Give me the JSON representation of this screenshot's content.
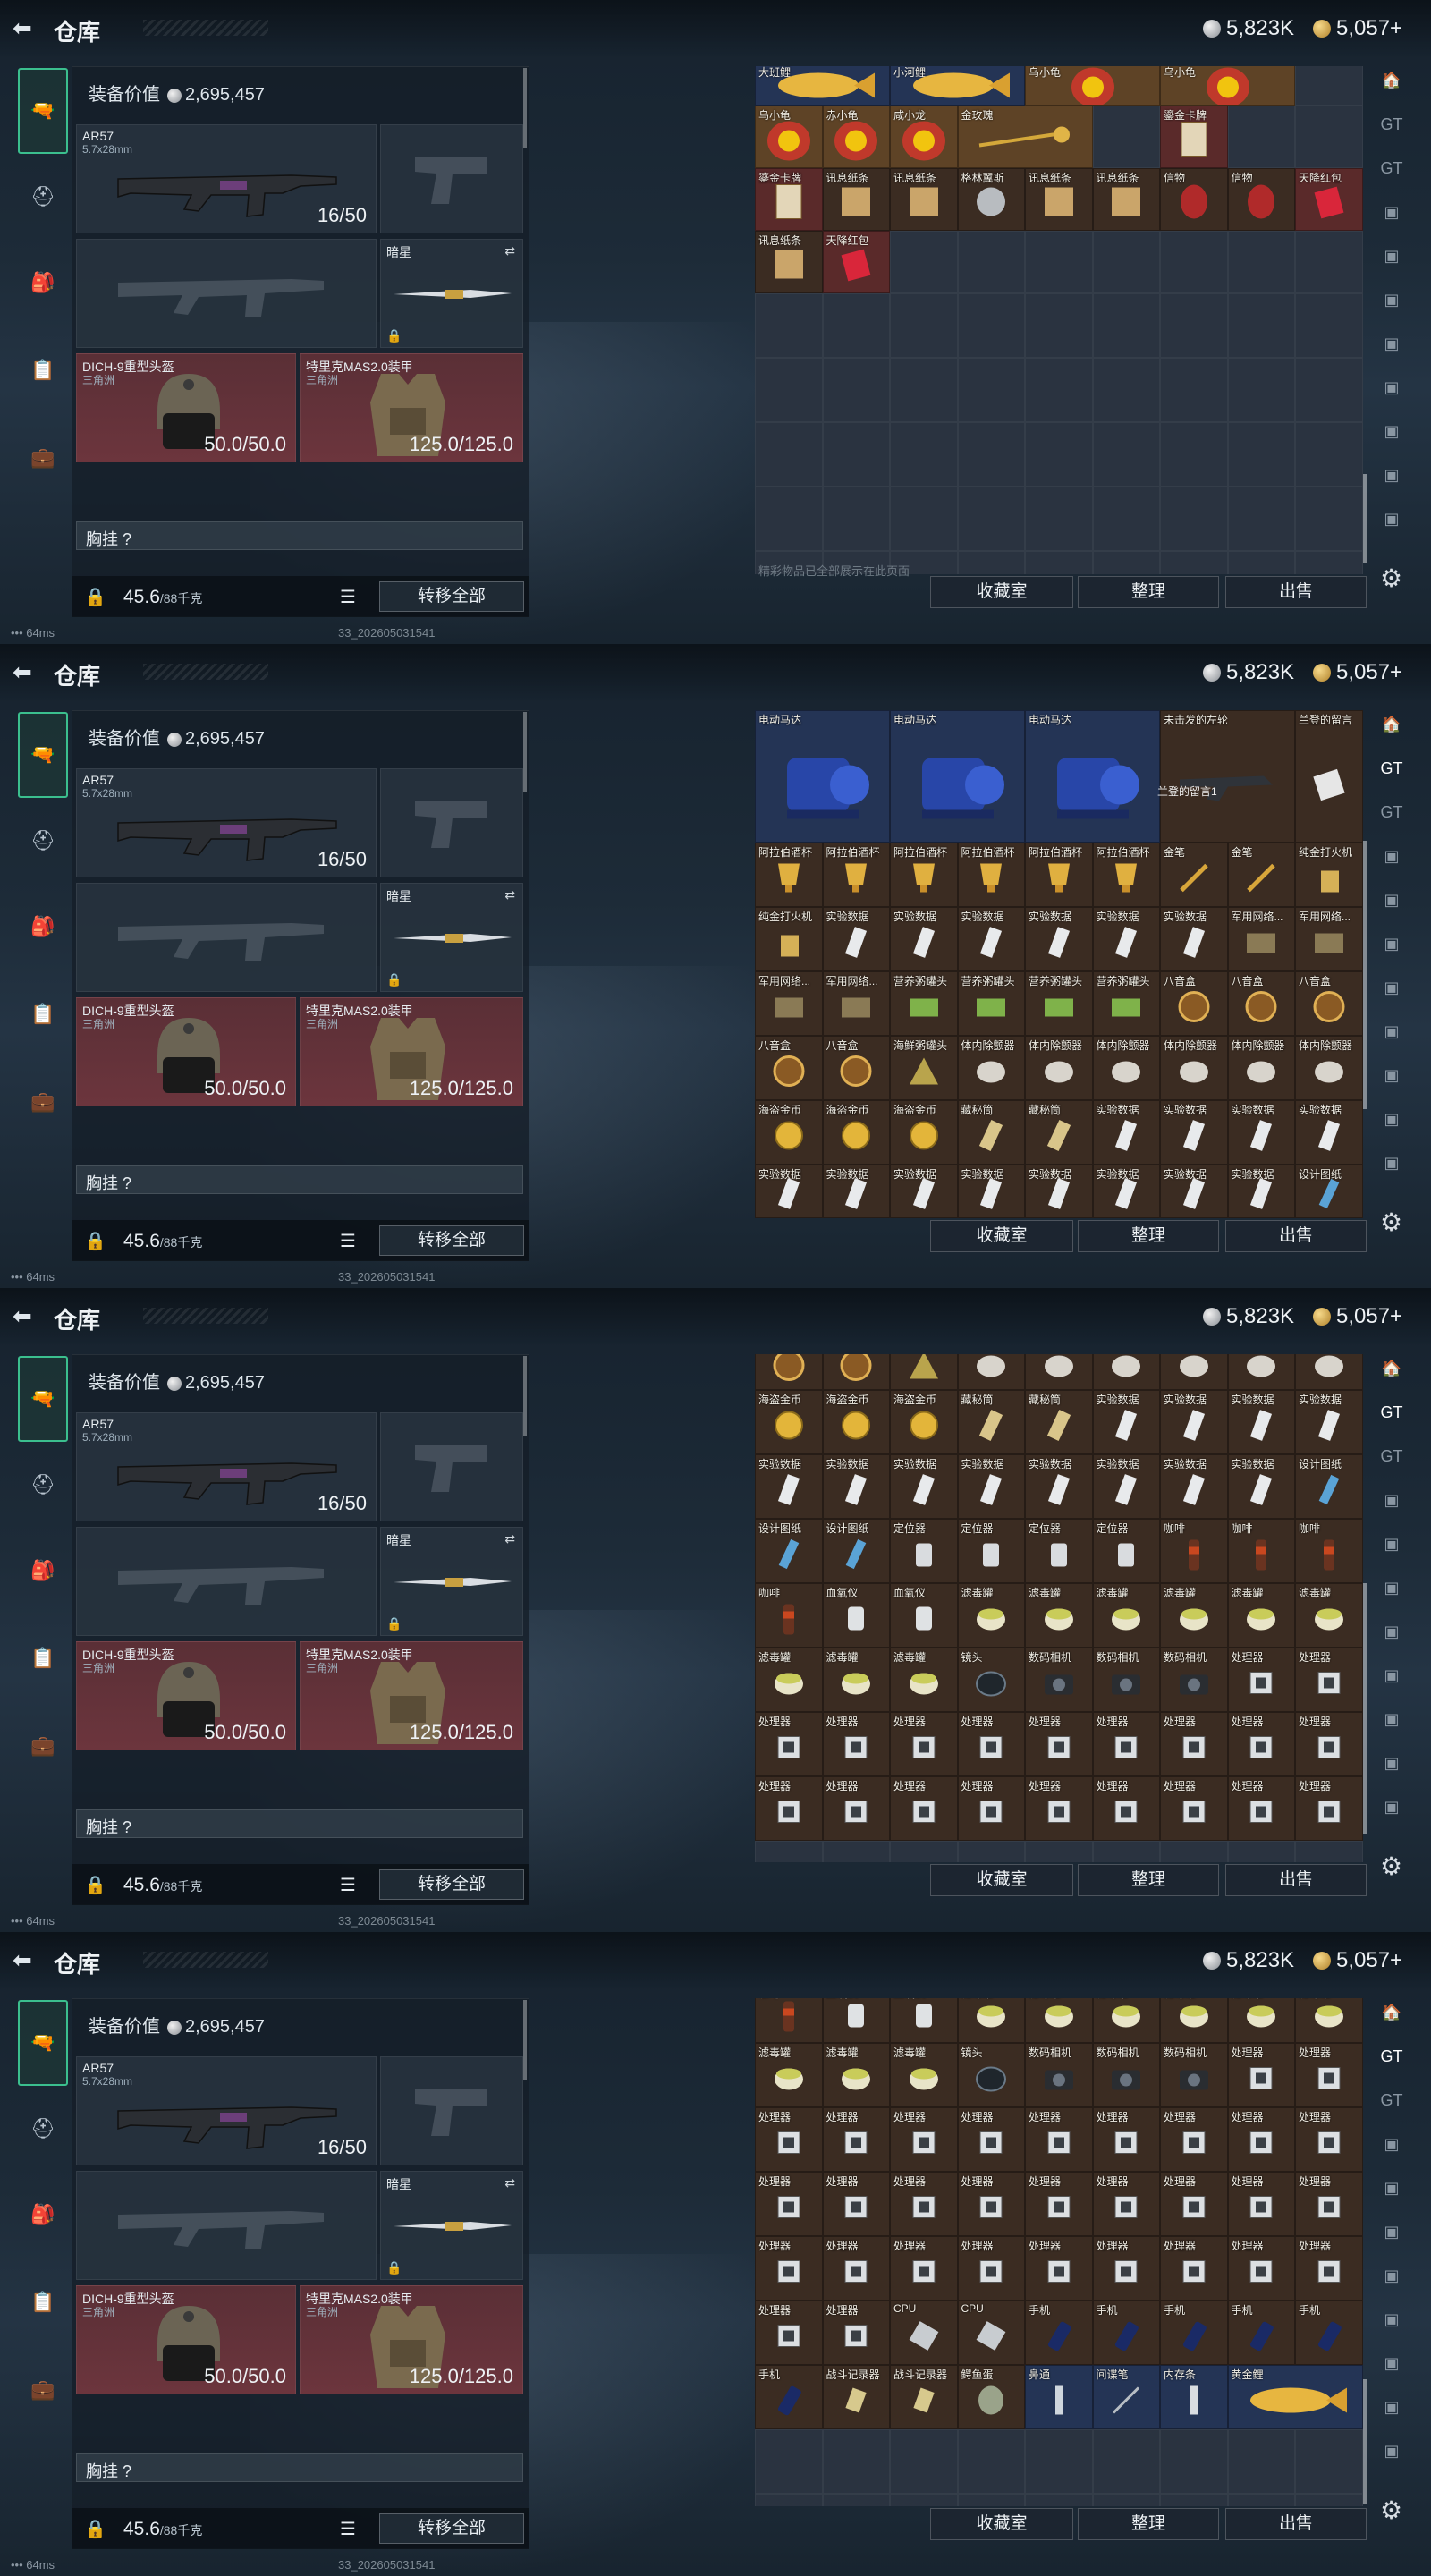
{
  "header": {
    "title": "仓库",
    "silver": "5,823K",
    "gold": "5,057+"
  },
  "equip": {
    "value_label": "装备价值",
    "value": "2,695,457",
    "weapon": {
      "name": "AR57",
      "ammo": "5.7x28mm",
      "count": "16/50"
    },
    "melee": {
      "name": "暗星"
    },
    "helmet": {
      "name": "DICH-9重型头盔",
      "sub": "三角洲",
      "dur": "50.0/50.0"
    },
    "armor": {
      "name": "特里克MAS2.0装甲",
      "sub": "三角洲",
      "dur": "125.0/125.0"
    },
    "chest": "胸挂 ?",
    "weight": "45.6",
    "weight_unit": "/88千克",
    "transfer": "转移全部"
  },
  "actions": {
    "collect": "收藏室",
    "sort": "整理",
    "sell": "出售"
  },
  "status": {
    "ping": "64ms",
    "version": "33_202605031541"
  },
  "panels": [
    {
      "rows": [
        [
          "大班鲤",
          "小河鲤",
          "乌小龟",
          "乌小龟",
          ""
        ],
        [
          "乌小龟",
          "赤小龟",
          "咸小龙",
          "金玫瑰",
          "",
          "鎏金卡牌"
        ],
        [
          "鎏金卡牌",
          "讯息纸条",
          "讯息纸条",
          "格林翼斯",
          "讯息纸条",
          "讯息纸条",
          "信物",
          "信物",
          "天降红包"
        ],
        [
          "讯息纸条",
          "天降红包"
        ]
      ],
      "fade": "精彩物品已全部展示在此页面"
    },
    {
      "rows": [
        [
          "电动马达",
          "电动马达",
          "电动马达",
          "未击发的左轮",
          "兰登的留言"
        ],
        [
          "阿拉伯酒杯",
          "阿拉伯酒杯",
          "阿拉伯酒杯",
          "阿拉伯酒杯",
          "阿拉伯酒杯",
          "阿拉伯酒杯",
          "金笔",
          "金笔",
          "纯金打火机"
        ],
        [
          "纯金打火机",
          "实验数据",
          "实验数据",
          "实验数据",
          "实验数据",
          "实验数据",
          "实验数据",
          "军用网络...",
          "军用网络..."
        ],
        [
          "军用网络...",
          "军用网络...",
          "营养粥罐头",
          "营养粥罐头",
          "营养粥罐头",
          "营养粥罐头",
          "八音盒",
          "八音盒",
          "八音盒"
        ],
        [
          "八音盒",
          "八音盒",
          "海鲜粥罐头",
          "体内除颤器",
          "体内除颤器",
          "体内除颤器",
          "体内除颤器",
          "体内除颤器",
          "体内除颤器"
        ],
        [
          "海盗金币",
          "海盗金币",
          "海盗金币",
          "藏秘筒",
          "藏秘筒",
          "实验数据",
          "实验数据",
          "实验数据",
          "实验数据"
        ],
        [
          "实验数据",
          "实验数据",
          "实验数据",
          "实验数据",
          "实验数据",
          "实验数据",
          "实验数据",
          "实验数据",
          "设计图纸"
        ]
      ],
      "note": "兰登的留言1"
    },
    {
      "rows": [
        [
          "八音盒",
          "八音盒",
          "海鲜粥罐头",
          "体内除颤器",
          "体内除颤器",
          "体内除颤器",
          "体内除颤器",
          "体内除颤器",
          "体内除颤器"
        ],
        [
          "海盗金币",
          "海盗金币",
          "海盗金币",
          "藏秘筒",
          "藏秘筒",
          "实验数据",
          "实验数据",
          "实验数据",
          "实验数据"
        ],
        [
          "实验数据",
          "实验数据",
          "实验数据",
          "实验数据",
          "实验数据",
          "实验数据",
          "实验数据",
          "实验数据",
          "设计图纸"
        ],
        [
          "设计图纸",
          "设计图纸",
          "定位器",
          "定位器",
          "定位器",
          "定位器",
          "咖啡",
          "咖啡",
          "咖啡"
        ],
        [
          "咖啡",
          "血氧仪",
          "血氧仪",
          "滤毒罐",
          "滤毒罐",
          "滤毒罐",
          "滤毒罐",
          "滤毒罐",
          "滤毒罐"
        ],
        [
          "滤毒罐",
          "滤毒罐",
          "滤毒罐",
          "镜头",
          "数码相机",
          "数码相机",
          "数码相机",
          "处理器",
          "处理器"
        ],
        [
          "处理器",
          "处理器",
          "处理器",
          "处理器",
          "处理器",
          "处理器",
          "处理器",
          "处理器",
          "处理器"
        ],
        [
          "处理器",
          "处理器",
          "处理器",
          "处理器",
          "处理器",
          "处理器",
          "处理器",
          "处理器",
          "处理器"
        ]
      ]
    },
    {
      "rows": [
        [
          "咖啡",
          "血氧仪",
          "血氧仪",
          "滤毒罐",
          "滤毒罐",
          "滤毒罐",
          "滤毒罐",
          "滤毒罐",
          "滤毒罐"
        ],
        [
          "滤毒罐",
          "滤毒罐",
          "滤毒罐",
          "镜头",
          "数码相机",
          "数码相机",
          "数码相机",
          "处理器",
          "处理器"
        ],
        [
          "处理器",
          "处理器",
          "处理器",
          "处理器",
          "处理器",
          "处理器",
          "处理器",
          "处理器",
          "处理器"
        ],
        [
          "处理器",
          "处理器",
          "处理器",
          "处理器",
          "处理器",
          "处理器",
          "处理器",
          "处理器",
          "处理器"
        ],
        [
          "处理器",
          "处理器",
          "处理器",
          "处理器",
          "处理器",
          "处理器",
          "处理器",
          "处理器",
          "处理器"
        ],
        [
          "处理器",
          "处理器",
          "CPU",
          "CPU",
          "手机",
          "手机",
          "手机",
          "手机",
          "手机"
        ],
        [
          "手机",
          "战斗记录器",
          "战斗记录器",
          "鳄鱼蛋",
          "鼻通",
          "间谍笔",
          "内存条",
          "黄金鲤"
        ]
      ]
    }
  ]
}
